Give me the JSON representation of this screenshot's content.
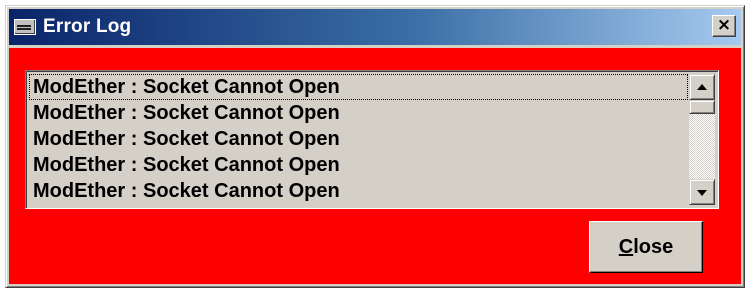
{
  "window": {
    "title": "Error Log",
    "close_glyph": "×",
    "icons": {
      "app": "app-window-icon",
      "close": "close-icon"
    }
  },
  "colors": {
    "client_background": "#ff0000",
    "titlebar_start": "#0a246a",
    "titlebar_end": "#a6caf0",
    "face": "#d4d0c8"
  },
  "error_list": {
    "items": [
      "ModEther : Socket Cannot Open",
      "ModEther : Socket Cannot Open",
      "ModEther : Socket Cannot Open",
      "ModEther : Socket Cannot Open",
      "ModEther : Socket Cannot Open"
    ],
    "focused_index": 0,
    "scroll_position": 0
  },
  "close_button": {
    "accel": "C",
    "rest": "lose"
  }
}
